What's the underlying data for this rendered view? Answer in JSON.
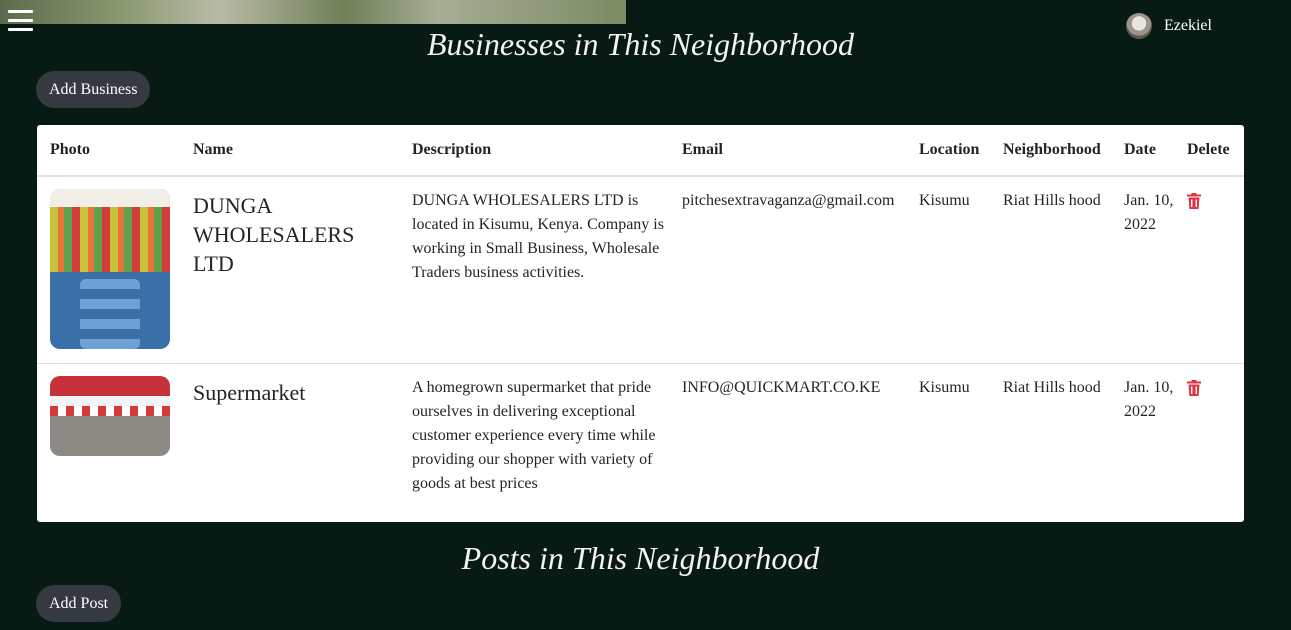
{
  "header": {
    "user_name": "Ezekiel"
  },
  "businesses": {
    "title": "Businesses in This Neighborhood",
    "add_label": "Add Business",
    "columns": [
      "Photo",
      "Name",
      "Description",
      "Email",
      "Location",
      "Neighborhood",
      "Date",
      "Delete"
    ],
    "rows": [
      {
        "name": "DUNGA WHOLESALERS LTD",
        "description": "DUNGA WHOLESALERS LTD is located in Kisumu, Kenya. Company is working in Small Business, Wholesale Traders business activities.",
        "email": "pitchesextravaganza@gmail.com",
        "location": "Kisumu",
        "neighborhood": "Riat Hills hood",
        "date": "Jan. 10, 2022"
      },
      {
        "name": "Supermarket",
        "description": "A homegrown supermarket that pride ourselves in delivering exceptional customer experience every time while providing our shopper with variety of goods at best prices",
        "email": "INFO@QUICKMART.CO.KE",
        "location": "Kisumu",
        "neighborhood": "Riat Hills hood",
        "date": "Jan. 10, 2022"
      }
    ]
  },
  "posts": {
    "title": "Posts in This Neighborhood",
    "add_label": "Add Post"
  },
  "colors": {
    "background": "#071a14",
    "button": "#343a40",
    "delete": "#dc3545"
  },
  "icons": {
    "menu": "hamburger-menu-icon",
    "delete": "trash-icon"
  }
}
